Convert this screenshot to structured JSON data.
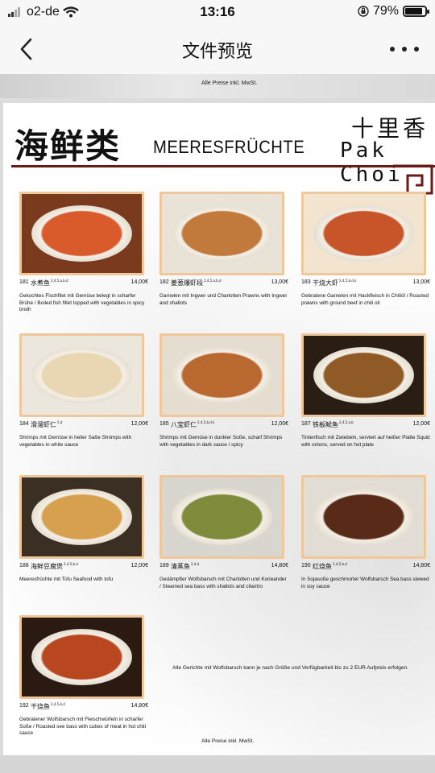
{
  "status_bar": {
    "carrier": "o2-de",
    "time": "13:16",
    "battery": "79%"
  },
  "nav": {
    "title": "文件预览"
  },
  "strip": {
    "vat": "Alle Preise inkl. MwSt."
  },
  "menu": {
    "heading_zh": "海鲜类",
    "heading_de": "MEERESFRÜCHTE",
    "logo_zh": "十里香",
    "logo_en": "Pak Choi",
    "items": [
      {
        "no": "181",
        "name_zh": "水煮鱼",
        "sup": "2,4,5,a,b,d",
        "price": "14,00€",
        "desc": "Gekochtes Fischfilet mit Gemüse belegt in scharfer Brühe / Boiled fish fillet topped with vegetables in spicy broth",
        "photo_bg": "#7a3a1e",
        "dish": "#d95a2b"
      },
      {
        "no": "182",
        "name_zh": "姜葱爆虾段",
        "sup": "2,4,5,a,b,d",
        "price": "13,00€",
        "desc": "Garnelen mit Ingwer und Charlotten Prawns with Ingwer and shallots",
        "photo_bg": "#e9e2d6",
        "dish": "#c27a3c"
      },
      {
        "no": "183",
        "name_zh": "干烧大虾",
        "sup": "2,4,5,b,d,k",
        "price": "13,00€",
        "desc": "Gebratene Garnelen mit Hackfleisch in Chiliöl / Roasted prawns with ground beef in chili oil",
        "photo_bg": "#f2e4cf",
        "dish": "#c8542a"
      },
      {
        "no": "184",
        "name_zh": "滑溜虾仁",
        "sup": "5,d",
        "price": "12,00€",
        "desc": "Shrimps mit Gemüse in heller Saße Shrimps with vegetables in white sauce",
        "photo_bg": "#ece7dd",
        "dish": "#e9d7b4"
      },
      {
        "no": "185",
        "name_zh": "八宝虾仁",
        "sup": "2,4,5,b,d,k",
        "price": "12,00€",
        "desc": "Shrimps mit Gemüse in dunkler Soße, scharf Shrimps with vegetables in dark sauce / spicy",
        "photo_bg": "#e4ddd0",
        "dish": "#b9682f"
      },
      {
        "no": "187",
        "name_zh": "铁板鱿鱼",
        "sup": "2,4,5,a,b",
        "price": "12,00€",
        "desc": "Tintenfisch mit Zwiebeln, serviert auf heißer Platte Squid with onions, served on hot plate",
        "photo_bg": "#2a1d14",
        "dish": "#8f5a26"
      },
      {
        "no": "188",
        "name_zh": "海鲜豆腐煲",
        "sup": "2,4,5,b,d",
        "price": "12,00€",
        "desc": "Meeresfrüchte mit Tofu Seafood with tofu",
        "photo_bg": "#3b2e22",
        "dish": "#d6a04e"
      },
      {
        "no": "189",
        "name_zh": "清蒸鱼",
        "sup": "2,4,d",
        "price": "14,80€",
        "desc": "Gedämpfter Wolfsbarsch mit Charlotten und Korieander / Steamed sea bass with shallots and cilantro",
        "photo_bg": "#d9d6cf",
        "dish": "#7f8a3a"
      },
      {
        "no": "190",
        "name_zh": "红烧鱼",
        "sup": "2,4,5,b,d",
        "price": "14,80€",
        "desc": "In Sojasoße geschmorter Wolfsbarsch Sea bass stewed in soy sauce",
        "photo_bg": "#e2ddd4",
        "dish": "#5a2a18"
      },
      {
        "no": "192",
        "name_zh": "干烧鱼",
        "sup": "2,4,5,b,d",
        "price": "14,80€",
        "desc": "Gebratener Wolfsbarsch mit Fleischwürfeln in scharfer Soße / Roasted see bass with cubes of meat in hot chili sauce",
        "photo_bg": "#2a1a12",
        "dish": "#b8461f"
      }
    ],
    "note": "Alle Gerichte mit Wolfsbarsch kann je nach Größe und Verfügbarkeit bis zu 2 EUR Aufpreis erfolgen.",
    "vat": "Alle Preise inkl. MwSt."
  }
}
